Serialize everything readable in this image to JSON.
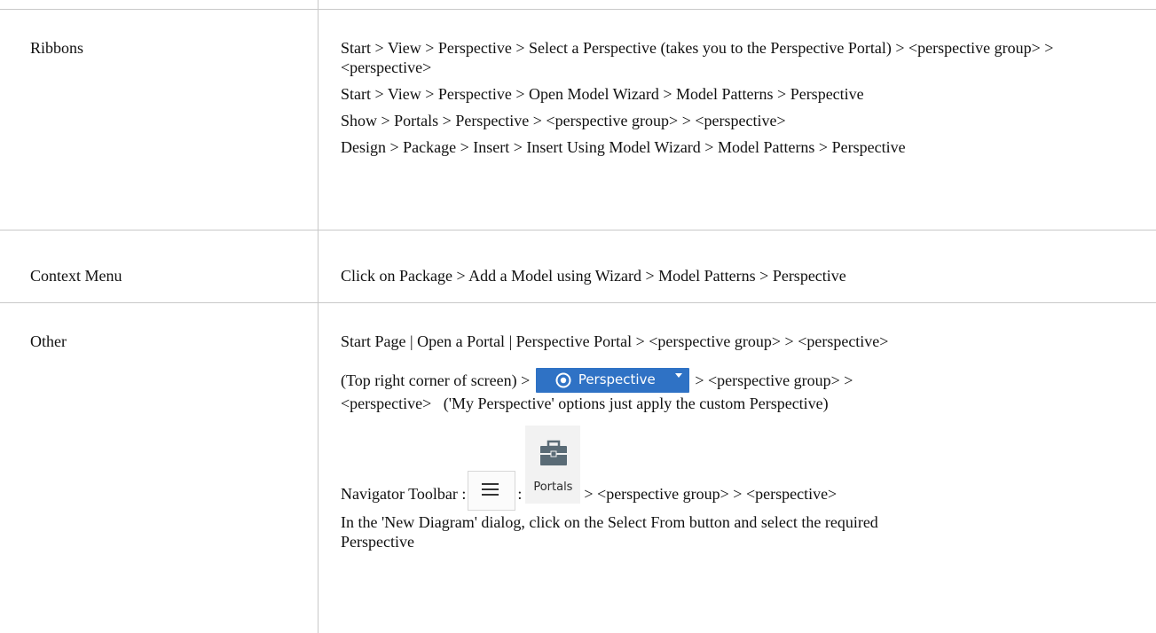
{
  "table": {
    "rows": [
      {
        "label": "Ribbons",
        "paths": [
          "Start > View > Perspective > Select a Perspective (takes you to the Perspective Portal) > <perspective group> > <perspective>",
          "Start > View > Perspective > Open Model Wizard > Model Patterns > Perspective",
          "Show > Portals > Perspective > <perspective group> > <perspective>",
          "Design > Package > Insert > Insert Using Model Wizard > Model Patterns > Perspective"
        ]
      },
      {
        "label": "Context Menu",
        "paths": [
          "Click on Package > Add a Model using Wizard > Model Patterns > Perspective"
        ]
      },
      {
        "label": "Other",
        "paths": [
          "Start Page | Open a Portal | Perspective Portal > <perspective group> > <perspective>"
        ],
        "top_right": {
          "before": "(Top right corner of screen) >",
          "button_label": "Perspective",
          "after": "> <perspective group> >",
          "line2": "<perspective>   ('My Perspective' options just apply the custom Perspective)"
        },
        "navigator": {
          "prefix": "Navigator Toolbar :",
          "separator": ":",
          "portals_label": "Portals",
          "suffix": "> <perspective group> > <perspective>"
        },
        "new_diagram_line1": "In the 'New Diagram' dialog, click on the Select From button and select the required",
        "new_diagram_line2": "Perspective"
      }
    ]
  },
  "colors": {
    "grid_line": "#c8c8c8",
    "button_blue": "#2f72c5",
    "button_text": "#ffffff"
  },
  "icons": {
    "perspective_button": "eye-icon",
    "navigator_menu": "hamburger-menu-icon",
    "portals": "briefcase-icon"
  }
}
